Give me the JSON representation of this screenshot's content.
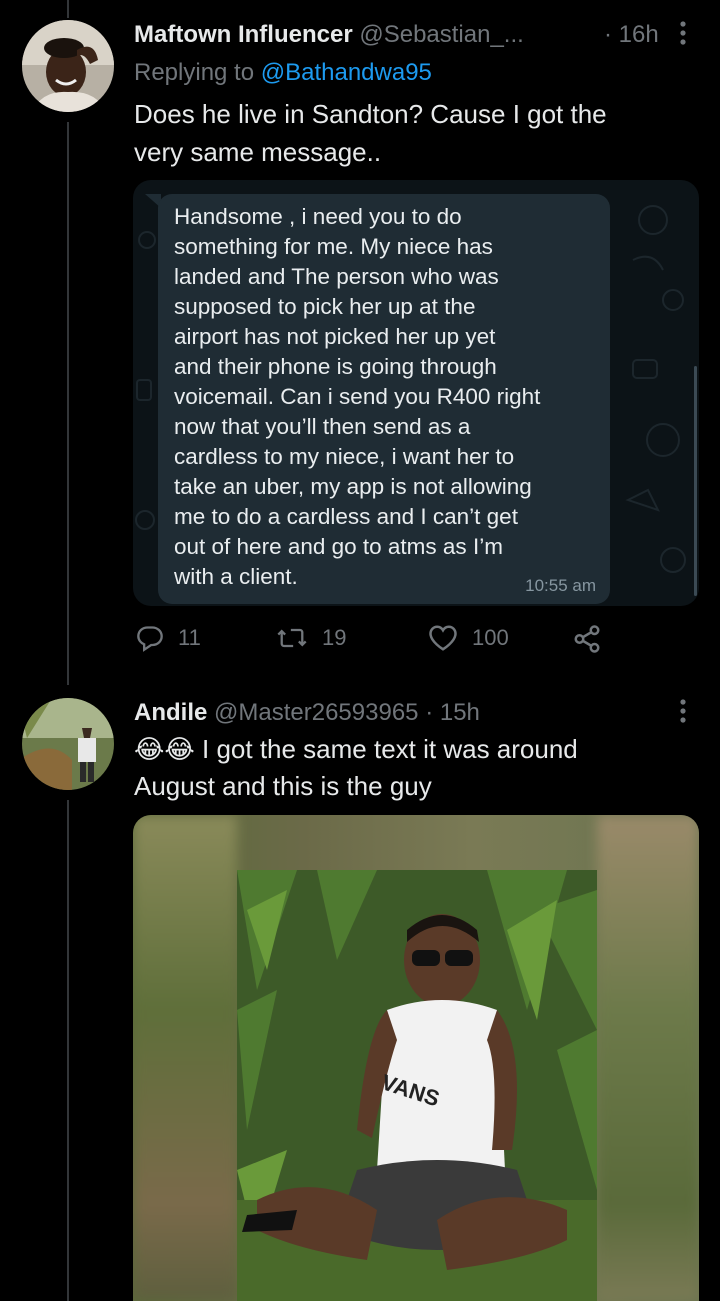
{
  "tweet1": {
    "display_name": "Maftown Influencer",
    "handle": "@Sebastian_...",
    "time": "· 16h",
    "replying_prefix": "Replying to",
    "replying_handle": "@Bathandwa95",
    "text_lines": [
      "Does he live in Sandton? Cause I got the",
      "very same message.."
    ],
    "media": {
      "message_lines": [
        "Handsome , i need you to do",
        "something for me. My niece has",
        "landed and The person who was",
        "supposed to pick her up at the",
        "airport has not picked her up yet",
        "and their phone is going through",
        "voicemail. Can i send you R400 right",
        "now that you’ll then send as a",
        "cardless to my niece, i want her to",
        "take an uber, my app is not allowing",
        "me to do a cardless and I can’t get",
        "out of here and go to atms as I’m",
        "with a client."
      ],
      "message_time": "10:55 am"
    },
    "actions": {
      "reply_count": "11",
      "retweet_count": "19",
      "like_count": "100"
    }
  },
  "tweet2": {
    "display_name": "Andile",
    "handle": "@Master26593965",
    "time": "· 15h",
    "emoji": "😂😂",
    "text_lines": [
      "I got the same text it was around",
      "August and this is the guy"
    ],
    "photo_shirt_text": "VANS"
  },
  "colors": {
    "background": "#000000",
    "text": "#e7e9ea",
    "muted": "#71767b",
    "link": "#1d9bf0",
    "bubble": "#1f2c34"
  },
  "icons": [
    "more-icon",
    "reply-icon",
    "retweet-icon",
    "like-icon",
    "share-icon"
  ]
}
